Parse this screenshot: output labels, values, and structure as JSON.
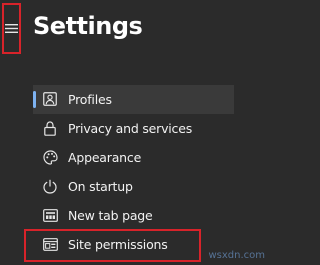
{
  "header": {
    "title": "Settings",
    "menu_icon": "hamburger-menu-icon"
  },
  "nav": {
    "items": [
      {
        "label": "Profiles",
        "icon": "profile-icon",
        "selected": true
      },
      {
        "label": "Privacy and services",
        "icon": "lock-icon",
        "selected": false
      },
      {
        "label": "Appearance",
        "icon": "palette-icon",
        "selected": false
      },
      {
        "label": "On startup",
        "icon": "power-icon",
        "selected": false
      },
      {
        "label": "New tab page",
        "icon": "new-tab-page-icon",
        "selected": false
      },
      {
        "label": "Site permissions",
        "icon": "site-permissions-icon",
        "selected": false
      }
    ]
  },
  "watermark": "wsxdn.com",
  "colors": {
    "background": "#2b2b2b",
    "selected_background": "#3a3a3a",
    "accent": "#7eb3f2",
    "annotation": "#d8232a",
    "text": "#f2f2f2"
  }
}
